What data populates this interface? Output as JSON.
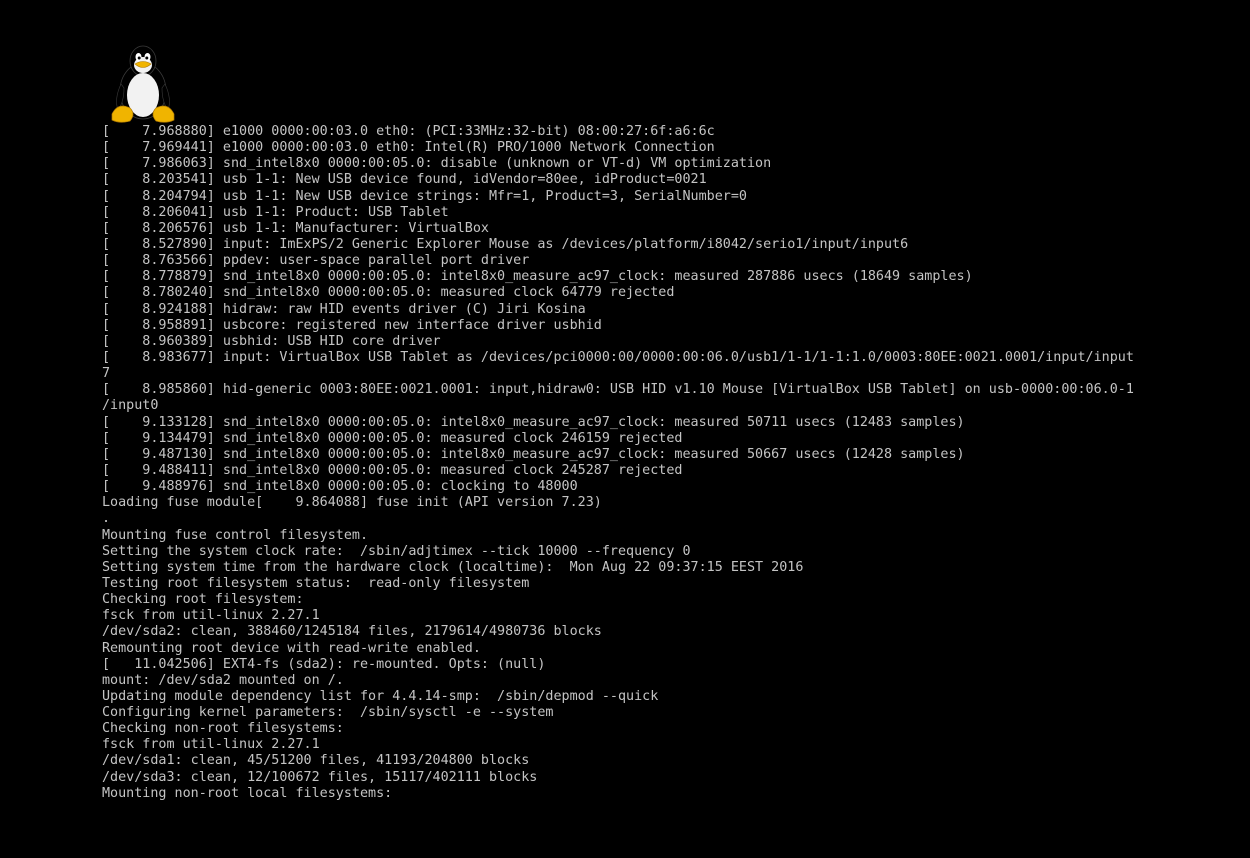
{
  "colors": {
    "background": "#000000",
    "text": "#c4c4c4",
    "tux_body": "#000000",
    "tux_belly": "#ffffff",
    "tux_beak_feet": "#f0b400"
  },
  "logo": {
    "icon": "tux-penguin-icon"
  },
  "console": {
    "lines": [
      "[    7.968880] e1000 0000:00:03.0 eth0: (PCI:33MHz:32-bit) 08:00:27:6f:a6:6c",
      "[    7.969441] e1000 0000:00:03.0 eth0: Intel(R) PRO/1000 Network Connection",
      "[    7.986063] snd_intel8x0 0000:00:05.0: disable (unknown or VT-d) VM optimization",
      "[    8.203541] usb 1-1: New USB device found, idVendor=80ee, idProduct=0021",
      "[    8.204794] usb 1-1: New USB device strings: Mfr=1, Product=3, SerialNumber=0",
      "[    8.206041] usb 1-1: Product: USB Tablet",
      "[    8.206576] usb 1-1: Manufacturer: VirtualBox",
      "[    8.527890] input: ImExPS/2 Generic Explorer Mouse as /devices/platform/i8042/serio1/input/input6",
      "[    8.763566] ppdev: user-space parallel port driver",
      "[    8.778879] snd_intel8x0 0000:00:05.0: intel8x0_measure_ac97_clock: measured 287886 usecs (18649 samples)",
      "[    8.780240] snd_intel8x0 0000:00:05.0: measured clock 64779 rejected",
      "[    8.924188] hidraw: raw HID events driver (C) Jiri Kosina",
      "[    8.958891] usbcore: registered new interface driver usbhid",
      "[    8.960389] usbhid: USB HID core driver",
      "[    8.983677] input: VirtualBox USB Tablet as /devices/pci0000:00/0000:00:06.0/usb1/1-1/1-1:1.0/0003:80EE:0021.0001/input/input",
      "7",
      "[    8.985860] hid-generic 0003:80EE:0021.0001: input,hidraw0: USB HID v1.10 Mouse [VirtualBox USB Tablet] on usb-0000:00:06.0-1",
      "/input0",
      "[    9.133128] snd_intel8x0 0000:00:05.0: intel8x0_measure_ac97_clock: measured 50711 usecs (12483 samples)",
      "[    9.134479] snd_intel8x0 0000:00:05.0: measured clock 246159 rejected",
      "[    9.487130] snd_intel8x0 0000:00:05.0: intel8x0_measure_ac97_clock: measured 50667 usecs (12428 samples)",
      "[    9.488411] snd_intel8x0 0000:00:05.0: measured clock 245287 rejected",
      "[    9.488976] snd_intel8x0 0000:00:05.0: clocking to 48000",
      "Loading fuse module[    9.864088] fuse init (API version 7.23)",
      ".",
      "Mounting fuse control filesystem.",
      "Setting the system clock rate:  /sbin/adjtimex --tick 10000 --frequency 0",
      "Setting system time from the hardware clock (localtime):  Mon Aug 22 09:37:15 EEST 2016",
      "Testing root filesystem status:  read-only filesystem",
      "Checking root filesystem:",
      "fsck from util-linux 2.27.1",
      "/dev/sda2: clean, 388460/1245184 files, 2179614/4980736 blocks",
      "Remounting root device with read-write enabled.",
      "[   11.042506] EXT4-fs (sda2): re-mounted. Opts: (null)",
      "mount: /dev/sda2 mounted on /.",
      "Updating module dependency list for 4.4.14-smp:  /sbin/depmod --quick",
      "Configuring kernel parameters:  /sbin/sysctl -e --system",
      "Checking non-root filesystems:",
      "fsck from util-linux 2.27.1",
      "/dev/sda1: clean, 45/51200 files, 41193/204800 blocks",
      "/dev/sda3: clean, 12/100672 files, 15117/402111 blocks",
      "Mounting non-root local filesystems:"
    ]
  }
}
